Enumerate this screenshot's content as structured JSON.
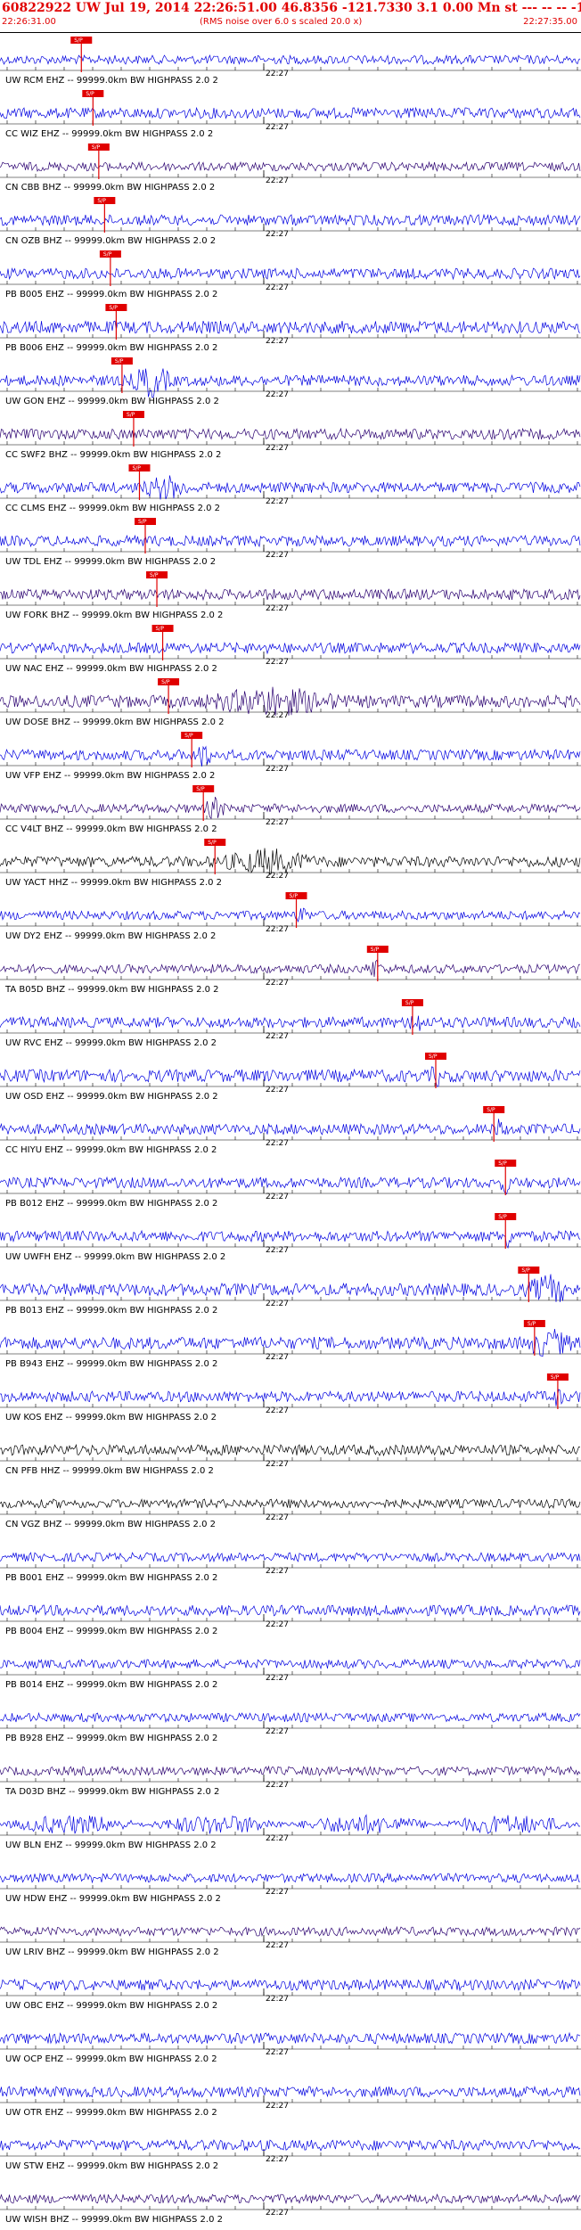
{
  "header": {
    "title": "60822922 UW Jul 19, 2014 22:26:51.00   46.8356 -121.7330  3.1 0.00 Mn st --- -- --   -1",
    "start_time": "22:26:31.00",
    "subtitle": "(RMS noise over 6.0 s scaled 20.0 x)",
    "end_time": "22:27:35.00"
  },
  "tick_label": "22:27",
  "pick_label": "S/P",
  "colors": {
    "header_text": "#e00000",
    "trace_blue": "#0000e0",
    "trace_purple": "#2a0070",
    "trace_black": "#000000",
    "pick": "#e00000"
  },
  "traces": [
    {
      "label": "UW RCM EHZ -- 99999.0km BW  HIGHPASS  2.0  2",
      "color": "trace_blue",
      "amp": 5,
      "pick": 0.14,
      "event": null
    },
    {
      "label": "CC WIZ EHZ -- 99999.0km BW  HIGHPASS  2.0  2",
      "color": "trace_blue",
      "amp": 6,
      "pick": 0.16,
      "event": null
    },
    {
      "label": "CN CBB BHZ -- 99999.0km BW  HIGHPASS  2.0  2",
      "color": "trace_purple",
      "amp": 5,
      "pick": 0.17,
      "event": null
    },
    {
      "label": "CN OZB BHZ -- 99999.0km BW  HIGHPASS  2.0  2",
      "color": "trace_blue",
      "amp": 6,
      "pick": 0.18,
      "event": null
    },
    {
      "label": "PB B005 EHZ -- 99999.0km BW  HIGHPASS  2.0  2",
      "color": "trace_blue",
      "amp": 6,
      "pick": 0.19,
      "event": null
    },
    {
      "label": "PB B006 EHZ -- 99999.0km BW  HIGHPASS  2.0  2",
      "color": "trace_blue",
      "amp": 7,
      "pick": 0.2,
      "event": null
    },
    {
      "label": "UW GON EHZ -- 99999.0km BW  HIGHPASS  2.0  2",
      "color": "trace_blue",
      "amp": 6,
      "pick": 0.21,
      "event": [
        0.22,
        0.3,
        16
      ]
    },
    {
      "label": "CC SWF2 BHZ -- 99999.0km BW  HIGHPASS  2.0  2",
      "color": "trace_purple",
      "amp": 6,
      "pick": 0.23,
      "event": null
    },
    {
      "label": "CC CLMS EHZ -- 99999.0km BW  HIGHPASS  2.0  2",
      "color": "trace_blue",
      "amp": 6,
      "pick": 0.24,
      "event": [
        0.24,
        0.33,
        10
      ]
    },
    {
      "label": "UW TDL EHZ -- 99999.0km BW  HIGHPASS  2.0  2",
      "color": "trace_blue",
      "amp": 6,
      "pick": 0.25,
      "event": null
    },
    {
      "label": "UW FORK BHZ -- 99999.0km BW  HIGHPASS  2.0  2",
      "color": "trace_purple",
      "amp": 6,
      "pick": 0.27,
      "event": null
    },
    {
      "label": "UW NAC EHZ -- 99999.0km BW  HIGHPASS  2.0  2",
      "color": "trace_blue",
      "amp": 6,
      "pick": 0.28,
      "event": null
    },
    {
      "label": "UW DOSE BHZ -- 99999.0km BW  HIGHPASS  2.0  2",
      "color": "trace_purple",
      "amp": 7,
      "pick": 0.29,
      "event": [
        0.34,
        0.6,
        12
      ]
    },
    {
      "label": "UW VFP EHZ -- 99999.0km BW  HIGHPASS  2.0  2",
      "color": "trace_blue",
      "amp": 6,
      "pick": 0.33,
      "event": [
        0.33,
        0.37,
        10
      ]
    },
    {
      "label": "CC V4LT BHZ -- 99999.0km BW  HIGHPASS  2.0  2",
      "color": "trace_purple",
      "amp": 5,
      "pick": 0.35,
      "event": [
        0.35,
        0.39,
        10
      ]
    },
    {
      "label": "UW YACT HHZ -- 99999.0km BW  HIGHPASS  2.0  2",
      "color": "trace_black",
      "amp": 6,
      "pick": 0.37,
      "event": [
        0.37,
        0.55,
        11
      ]
    },
    {
      "label": "UW DY2 EHZ -- 99999.0km BW  HIGHPASS  2.0  2",
      "color": "trace_blue",
      "amp": 5,
      "pick": 0.51,
      "event": [
        0.51,
        0.53,
        9
      ]
    },
    {
      "label": "TA B05D BHZ -- 99999.0km BW  HIGHPASS  2.0  2",
      "color": "trace_purple",
      "amp": 5,
      "pick": 0.65,
      "event": [
        0.63,
        0.66,
        10
      ]
    },
    {
      "label": "UW RVC EHZ -- 99999.0km BW  HIGHPASS  2.0  2",
      "color": "trace_blue",
      "amp": 6,
      "pick": 0.71,
      "event": [
        0.7,
        0.73,
        12
      ]
    },
    {
      "label": "UW OSD EHZ -- 99999.0km BW  HIGHPASS  2.0  2",
      "color": "trace_blue",
      "amp": 7,
      "pick": 0.75,
      "event": [
        0.74,
        0.76,
        10
      ]
    },
    {
      "label": "CC HIYU EHZ -- 99999.0km BW  HIGHPASS  2.0  2",
      "color": "trace_blue",
      "amp": 6,
      "pick": 0.85,
      "event": [
        0.85,
        0.87,
        9
      ]
    },
    {
      "label": "PB B012 EHZ -- 99999.0km BW  HIGHPASS  2.0  2",
      "color": "trace_blue",
      "amp": 6,
      "pick": 0.87,
      "event": [
        0.86,
        0.88,
        9
      ]
    },
    {
      "label": "UW UWFH EHZ -- 99999.0km BW  HIGHPASS  2.0  2",
      "color": "trace_blue",
      "amp": 6,
      "pick": 0.87,
      "event": [
        0.86,
        0.89,
        10
      ]
    },
    {
      "label": "PB B013 EHZ -- 99999.0km BW  HIGHPASS  2.0  2",
      "color": "trace_blue",
      "amp": 7,
      "pick": 0.91,
      "event": [
        0.9,
        0.99,
        12
      ]
    },
    {
      "label": "PB B943 EHZ -- 99999.0km BW  HIGHPASS  2.0  2",
      "color": "trace_blue",
      "amp": 7,
      "pick": 0.92,
      "event": [
        0.9,
        0.99,
        12
      ]
    },
    {
      "label": "UW KOS EHZ -- 99999.0km BW  HIGHPASS  2.0  2",
      "color": "trace_blue",
      "amp": 6,
      "pick": 0.96,
      "event": [
        0.95,
        0.97,
        8
      ]
    },
    {
      "label": "CN PFB HHZ -- 99999.0km BW  HIGHPASS  2.0  2",
      "color": "trace_black",
      "amp": 6,
      "pick": null,
      "event": null
    },
    {
      "label": "CN VGZ BHZ -- 99999.0km BW  HIGHPASS  2.0  2",
      "color": "trace_black",
      "amp": 5,
      "pick": null,
      "event": null
    },
    {
      "label": "PB B001 EHZ -- 99999.0km BW  HIGHPASS  2.0  2",
      "color": "trace_blue",
      "amp": 5,
      "pick": null,
      "event": null
    },
    {
      "label": "PB B004 EHZ -- 99999.0km BW  HIGHPASS  2.0  2",
      "color": "trace_blue",
      "amp": 6,
      "pick": null,
      "event": null
    },
    {
      "label": "PB B014 EHZ -- 99999.0km BW  HIGHPASS  2.0  2",
      "color": "trace_blue",
      "amp": 5,
      "pick": null,
      "event": null
    },
    {
      "label": "PB B928 EHZ -- 99999.0km BW  HIGHPASS  2.0  2",
      "color": "trace_blue",
      "amp": 5,
      "pick": null,
      "event": null
    },
    {
      "label": "TA D03D BHZ -- 99999.0km BW  HIGHPASS  2.0  2",
      "color": "trace_purple",
      "amp": 5,
      "pick": null,
      "event": null
    },
    {
      "label": "UW BLN EHZ -- 99999.0km BW  HIGHPASS  2.0  2",
      "color": "trace_blue",
      "amp": 9,
      "pick": null,
      "event": null
    },
    {
      "label": "UW HDW EHZ -- 99999.0km BW  HIGHPASS  2.0  2",
      "color": "trace_blue",
      "amp": 5,
      "pick": null,
      "event": null
    },
    {
      "label": "UW LRIV BHZ -- 99999.0km BW  HIGHPASS  2.0  2",
      "color": "trace_purple",
      "amp": 5,
      "pick": null,
      "event": null
    },
    {
      "label": "UW OBC EHZ -- 99999.0km BW  HIGHPASS  2.0  2",
      "color": "trace_blue",
      "amp": 6,
      "pick": null,
      "event": null
    },
    {
      "label": "UW OCP EHZ -- 99999.0km BW  HIGHPASS  2.0  2",
      "color": "trace_blue",
      "amp": 6,
      "pick": null,
      "event": null
    },
    {
      "label": "UW OTR EHZ -- 99999.0km BW  HIGHPASS  2.0  2",
      "color": "trace_blue",
      "amp": 6,
      "pick": null,
      "event": null
    },
    {
      "label": "UW STW EHZ -- 99999.0km BW  HIGHPASS  2.0  2",
      "color": "trace_blue",
      "amp": 6,
      "pick": null,
      "event": null
    },
    {
      "label": "UW WISH BHZ -- 99999.0km BW  HIGHPASS  2.0  2",
      "color": "trace_purple",
      "amp": 5,
      "pick": null,
      "event": null
    }
  ]
}
